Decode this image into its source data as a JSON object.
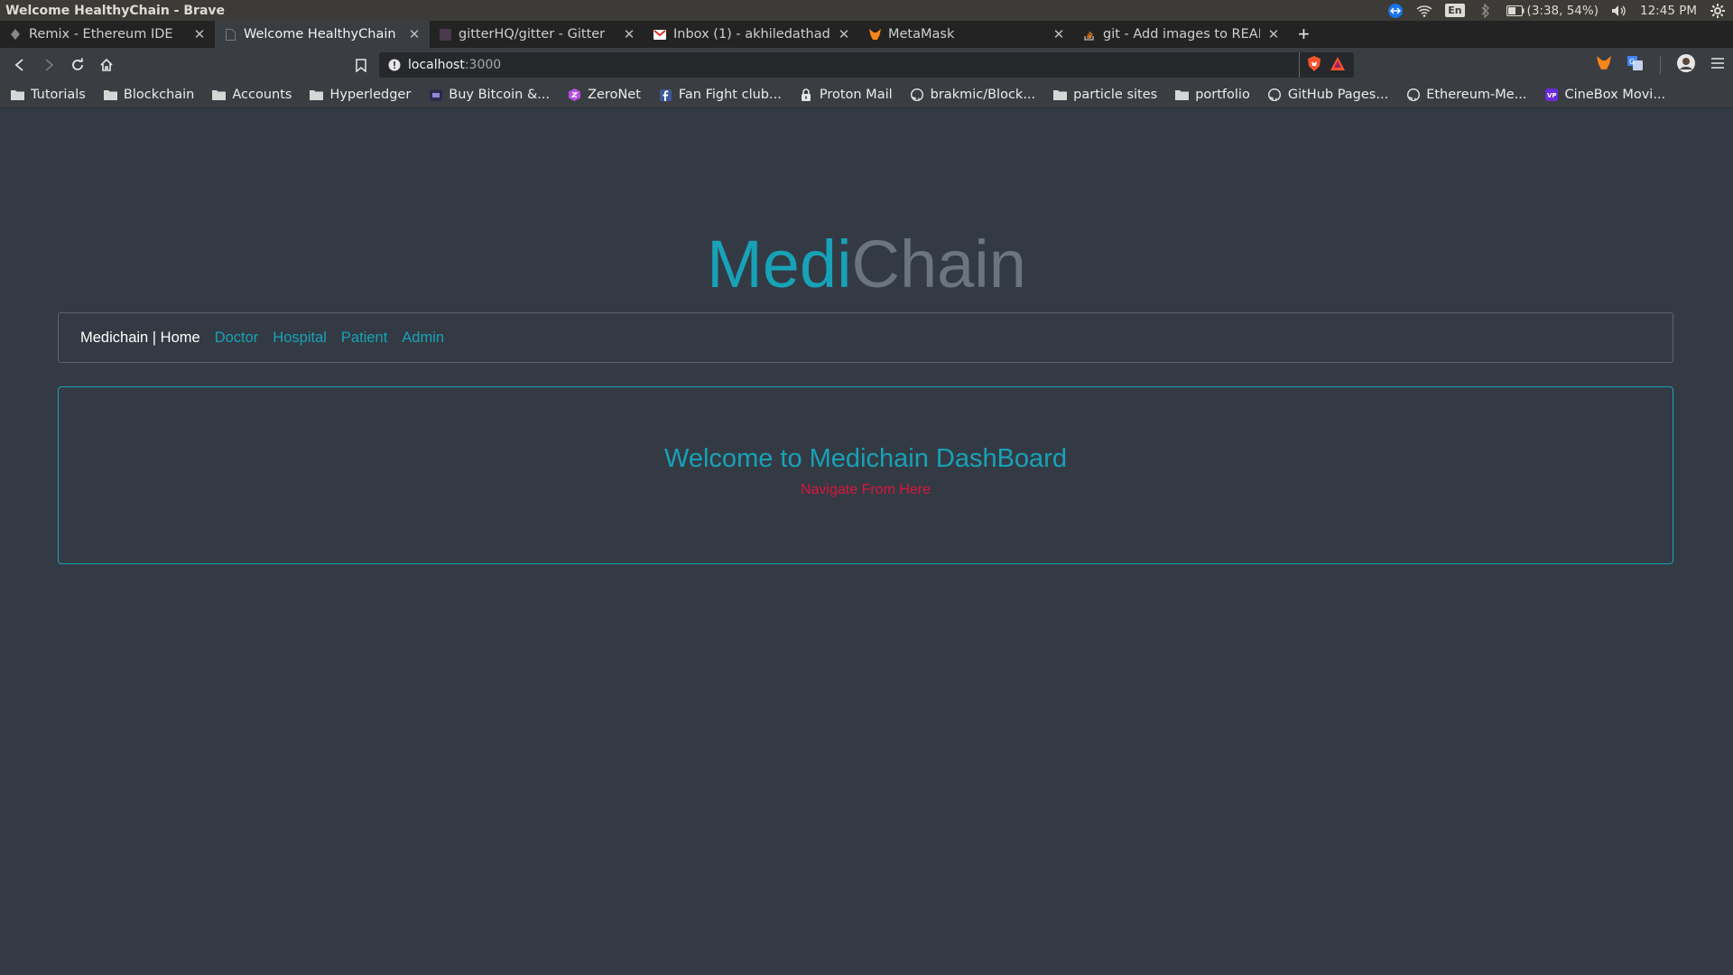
{
  "os": {
    "window_title": "Welcome HealthyChain - Brave",
    "keyboard_layout": "En",
    "battery": "(3:38, 54%)",
    "clock": "12:45 PM"
  },
  "tabs": [
    {
      "title": "Remix - Ethereum IDE",
      "active": false
    },
    {
      "title": "Welcome HealthyChain",
      "active": true
    },
    {
      "title": "gitterHQ/gitter - Gitter",
      "active": false
    },
    {
      "title": "Inbox (1) - akhiledathadan",
      "active": false
    },
    {
      "title": "MetaMask",
      "active": false
    },
    {
      "title": "git - Add images to READM",
      "active": false
    }
  ],
  "address": {
    "host": "localhost",
    "port": ":3000"
  },
  "bookmarks": [
    {
      "label": "Tutorials",
      "icon": "folder-icon"
    },
    {
      "label": "Blockchain",
      "icon": "folder-icon"
    },
    {
      "label": "Accounts",
      "icon": "folder-icon"
    },
    {
      "label": "Hyperledger",
      "icon": "folder-icon"
    },
    {
      "label": "Buy Bitcoin &...",
      "icon": "bitcoin-site-icon"
    },
    {
      "label": "ZeroNet",
      "icon": "zeronet-icon"
    },
    {
      "label": "Fan Fight club...",
      "icon": "facebook-icon"
    },
    {
      "label": "Proton Mail",
      "icon": "lock-icon"
    },
    {
      "label": "brakmic/Block...",
      "icon": "github-icon"
    },
    {
      "label": "particle sites",
      "icon": "folder-icon"
    },
    {
      "label": "portfolio",
      "icon": "folder-icon"
    },
    {
      "label": "GitHub Pages...",
      "icon": "github-icon"
    },
    {
      "label": "Ethereum-Me...",
      "icon": "github-icon"
    },
    {
      "label": "CineBox Movi...",
      "icon": "vp-icon"
    }
  ],
  "brand": {
    "part1": "Medi",
    "part2": "Chain"
  },
  "nav": {
    "home": "Medichain | Home",
    "links": [
      "Doctor",
      "Hospital",
      "Patient",
      "Admin"
    ]
  },
  "dashboard": {
    "heading": "Welcome to Medichain DashBoard",
    "subtext": "Navigate From Here"
  },
  "colors": {
    "accent": "#17a2b8",
    "muted": "#6c757d",
    "danger": "#dc143c",
    "background": "#343a43"
  }
}
